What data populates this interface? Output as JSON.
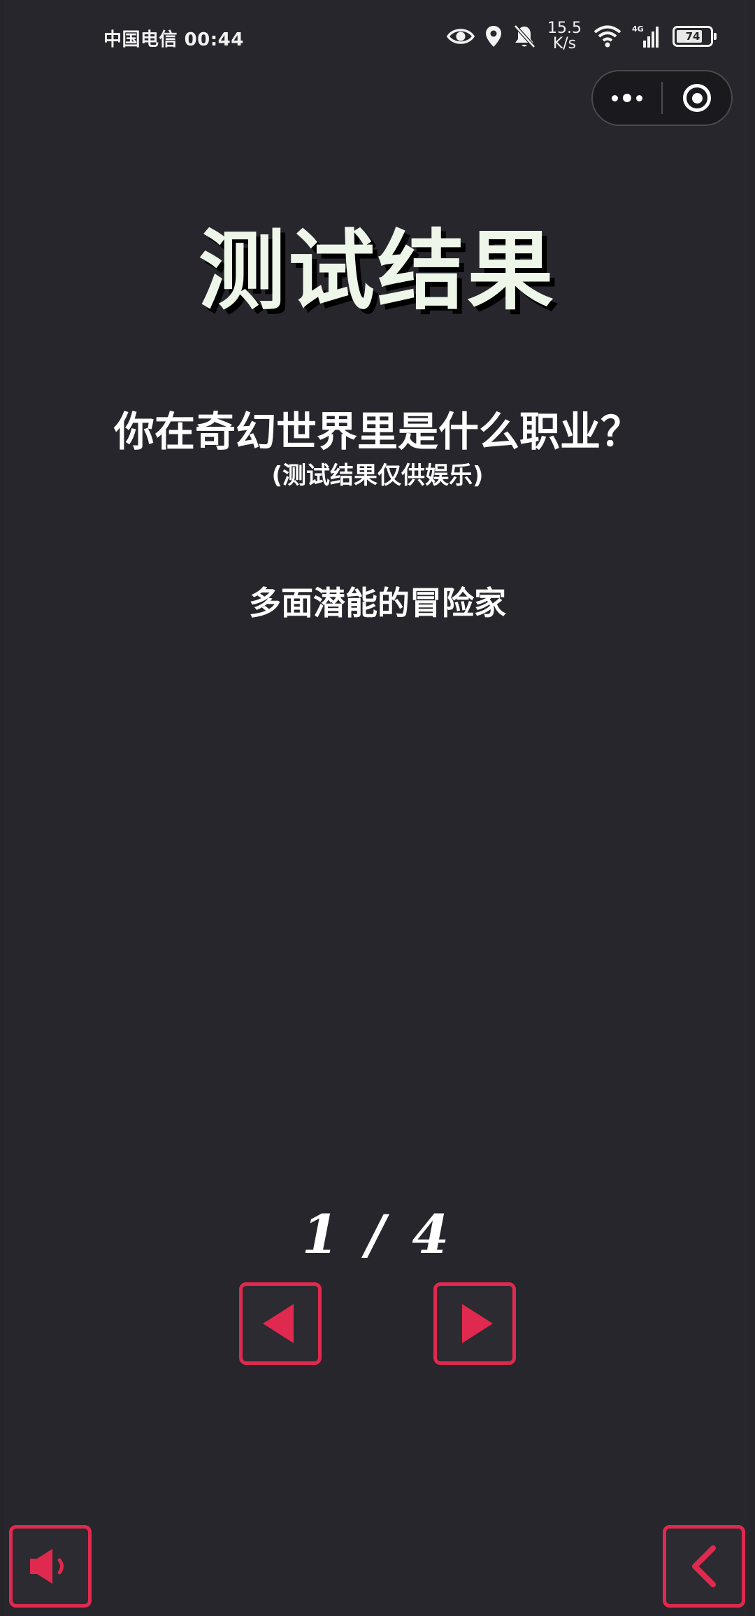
{
  "status_bar": {
    "carrier": "中国电信",
    "time": "00:44",
    "net_speed_value": "15.5",
    "net_speed_unit": "K/s",
    "network_type": "4G",
    "battery_level": "74",
    "icons": [
      "eye-icon",
      "location-icon",
      "bell-muted-icon",
      "wifi-icon",
      "signal-icon",
      "battery-icon"
    ]
  },
  "capsule": {
    "icons": [
      "more-dots-icon",
      "close-target-icon"
    ]
  },
  "page": {
    "title": "测试结果",
    "question": "你在奇幻世界里是什么职业？",
    "disclaimer": "(测试结果仅供娱乐)",
    "result": "多面潜能的冒险家",
    "pager": "1 / 4"
  },
  "controls": {
    "prev_icon": "triangle-left-icon",
    "next_icon": "triangle-right-icon",
    "sound_icon": "speaker-icon",
    "back_icon": "chevron-left-icon"
  },
  "colors": {
    "background": "#26262c",
    "accent": "#e0294e",
    "title_text": "#eef6ea",
    "text": "#ffffff"
  }
}
